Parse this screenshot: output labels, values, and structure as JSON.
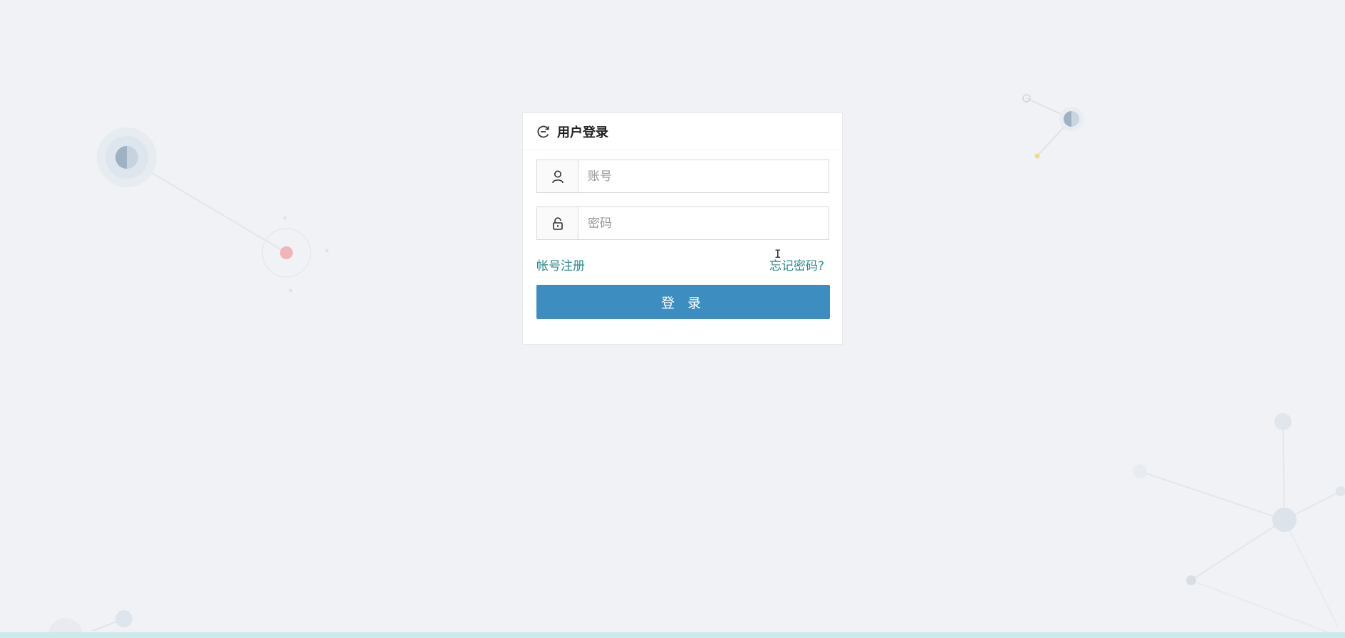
{
  "login": {
    "title": "用户登录",
    "title_icon": "refresh-circle-icon",
    "account": {
      "placeholder": "账号",
      "value": "",
      "icon": "user-icon"
    },
    "password": {
      "placeholder": "密码",
      "value": "",
      "icon": "lock-icon"
    },
    "register_link": "帐号注册",
    "forgot_link": "忘记密码?",
    "submit_label": "登 录"
  },
  "colors": {
    "background": "#f0f2f5",
    "primary_button": "#3e8dc0",
    "link": "#2b8a8a",
    "card": "#ffffff"
  }
}
